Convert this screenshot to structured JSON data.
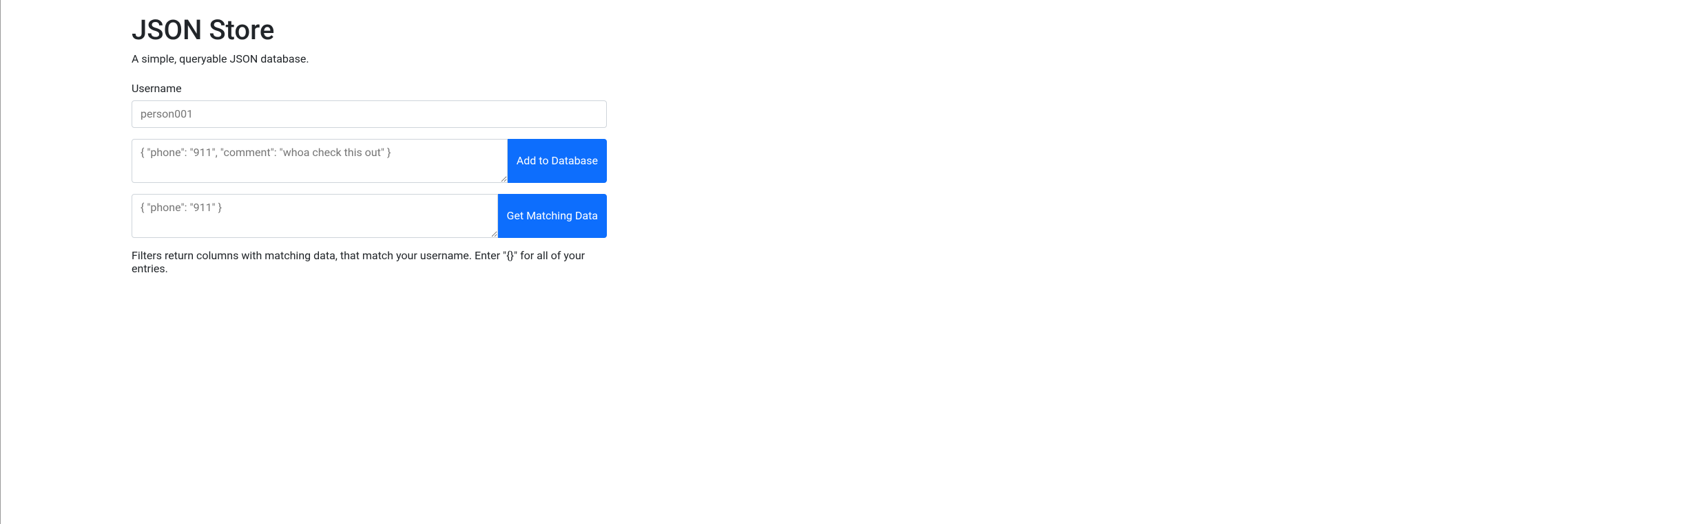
{
  "header": {
    "title": "JSON Store",
    "subtitle": "A simple, queryable JSON database."
  },
  "form": {
    "username_label": "Username",
    "username_placeholder": "person001",
    "add_placeholder": "{ \"phone\": \"911\", \"comment\": \"whoa check this out\" }",
    "add_button_label": "Add to Database",
    "filter_placeholder": "{ \"phone\": \"911\" }",
    "filter_button_label": "Get Matching Data",
    "help_text": "Filters return columns with matching data, that match your username. Enter \"{}\" for all of your entries."
  }
}
